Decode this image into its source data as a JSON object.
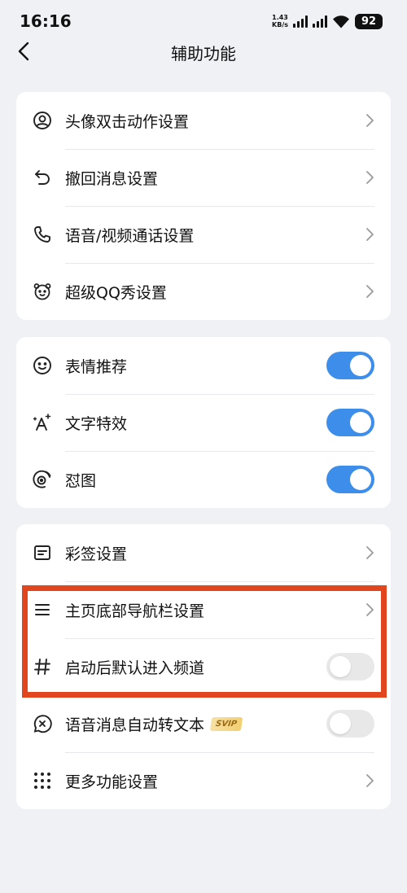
{
  "status_bar": {
    "time": "16:16",
    "net_speed_value": "1.43",
    "net_speed_unit": "KB/s",
    "battery": "92"
  },
  "nav": {
    "title": "辅助功能"
  },
  "section1": {
    "items": [
      {
        "label": "头像双击动作设置",
        "icon": "avatar-icon"
      },
      {
        "label": "撤回消息设置",
        "icon": "undo-icon"
      },
      {
        "label": "语音/视频通话设置",
        "icon": "phone-icon"
      },
      {
        "label": "超级QQ秀设置",
        "icon": "qq-show-icon"
      }
    ]
  },
  "section2": {
    "items": [
      {
        "label": "表情推荐",
        "icon": "smiley-icon",
        "enabled": true
      },
      {
        "label": "文字特效",
        "icon": "text-effect-icon",
        "enabled": true
      },
      {
        "label": "怼图",
        "icon": "sticker-face-icon",
        "enabled": true
      }
    ]
  },
  "section3": {
    "items": [
      {
        "label": "彩签设置",
        "icon": "note-icon"
      },
      {
        "label": "主页底部导航栏设置",
        "icon": "menu-lines-icon"
      },
      {
        "label": "启动后默认进入频道",
        "icon": "hash-icon",
        "enabled": false
      },
      {
        "label": "语音消息自动转文本",
        "icon": "voice-text-icon",
        "enabled": false,
        "badge": "SVIP"
      },
      {
        "label": "更多功能设置",
        "icon": "grid-dots-icon"
      }
    ]
  },
  "colors": {
    "background": "#eff1f5",
    "toggle_on": "#3d8eea",
    "toggle_off": "#e8e8e8",
    "highlight": "#e2461f"
  }
}
